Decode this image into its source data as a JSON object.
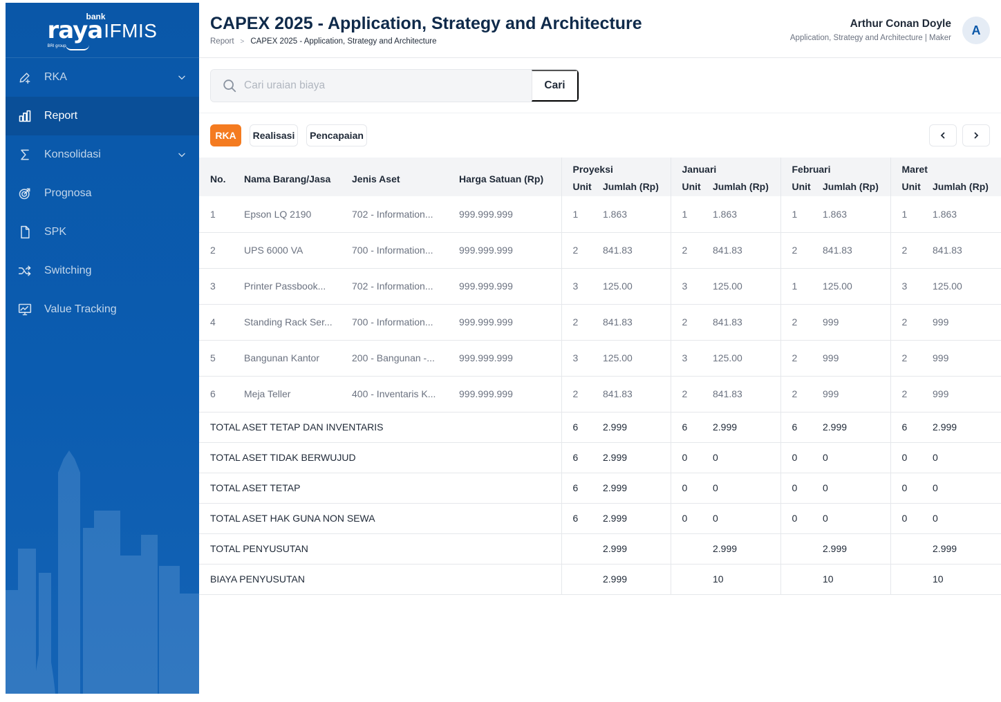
{
  "app": {
    "logo_bank": "bank",
    "logo_raya": "raya",
    "logo_ifmis": "IFMIS",
    "logo_sub": "BRI group"
  },
  "sidebar": {
    "items": [
      {
        "label": "RKA",
        "icon": "edit-plus-icon",
        "chevron": true
      },
      {
        "label": "Report",
        "icon": "bar-chart-icon",
        "active": true
      },
      {
        "label": "Konsolidasi",
        "icon": "sigma-icon",
        "chevron": true
      },
      {
        "label": "Prognosa",
        "icon": "target-icon"
      },
      {
        "label": "SPK",
        "icon": "file-icon"
      },
      {
        "label": "Switching",
        "icon": "shuffle-icon"
      },
      {
        "label": "Value Tracking",
        "icon": "monitor-chart-icon"
      }
    ]
  },
  "header": {
    "title": "CAPEX 2025 - Application, Strategy and Architecture",
    "breadcrumb": [
      "Report",
      "CAPEX 2025 - Application, Strategy and Architecture"
    ],
    "breadcrumb_sep": ">",
    "user_name": "Arthur Conan Doyle",
    "user_role": "Application, Strategy and Architecture | Maker",
    "avatar_initial": "A"
  },
  "search": {
    "placeholder": "Cari uraian biaya",
    "value": "",
    "button_label": "Cari"
  },
  "tabs": [
    {
      "label": "RKA",
      "active": true
    },
    {
      "label": "Realisasi",
      "active": false
    },
    {
      "label": "Pencapaian",
      "active": false
    }
  ],
  "pager": {
    "prev_icon": "chevron-left-icon",
    "next_icon": "chevron-right-icon"
  },
  "table": {
    "headers": {
      "no": "No.",
      "nama": "Nama Barang/Jasa",
      "jenis": "Jenis Aset",
      "harga": "Harga Satuan (Rp)",
      "unit": "Unit",
      "jumlah": "Jumlah (Rp)"
    },
    "groups": [
      "Proyeksi",
      "Januari",
      "Februari",
      "Maret"
    ],
    "rows": [
      {
        "no": "1",
        "nama": "Epson LQ 2190",
        "jenis": "702 - Information...",
        "harga": "999.999.999",
        "values": [
          [
            "1",
            "1.863"
          ],
          [
            "1",
            "1.863"
          ],
          [
            "1",
            "1.863"
          ],
          [
            "1",
            "1.863"
          ]
        ]
      },
      {
        "no": "2",
        "nama": "UPS 6000 VA",
        "jenis": "700 - Information...",
        "harga": "999.999.999",
        "values": [
          [
            "2",
            "841.83"
          ],
          [
            "2",
            "841.83"
          ],
          [
            "2",
            "841.83"
          ],
          [
            "2",
            "841.83"
          ]
        ]
      },
      {
        "no": "3",
        "nama": "Printer Passbook...",
        "jenis": "702 - Information...",
        "harga": "999.999.999",
        "values": [
          [
            "3",
            "125.00"
          ],
          [
            "3",
            "125.00"
          ],
          [
            "1",
            "125.00"
          ],
          [
            "3",
            "125.00"
          ]
        ]
      },
      {
        "no": "4",
        "nama": "Standing Rack Ser...",
        "jenis": "700 - Information...",
        "harga": "999.999.999",
        "values": [
          [
            "2",
            "841.83"
          ],
          [
            "2",
            "841.83"
          ],
          [
            "2",
            "999"
          ],
          [
            "2",
            "999"
          ]
        ]
      },
      {
        "no": "5",
        "nama": "Bangunan Kantor",
        "jenis": "200 - Bangunan -...",
        "harga": "999.999.999",
        "values": [
          [
            "3",
            "125.00"
          ],
          [
            "3",
            "125.00"
          ],
          [
            "2",
            "999"
          ],
          [
            "2",
            "999"
          ]
        ]
      },
      {
        "no": "6",
        "nama": "Meja Teller",
        "jenis": "400 - Inventaris K...",
        "harga": "999.999.999",
        "values": [
          [
            "2",
            "841.83"
          ],
          [
            "2",
            "841.83"
          ],
          [
            "2",
            "999"
          ],
          [
            "2",
            "999"
          ]
        ]
      }
    ],
    "totals": [
      {
        "label": "TOTAL ASET TETAP DAN INVENTARIS",
        "values": [
          [
            "6",
            "2.999"
          ],
          [
            "6",
            "2.999"
          ],
          [
            "6",
            "2.999"
          ],
          [
            "6",
            "2.999"
          ]
        ]
      },
      {
        "label": "TOTAL ASET TIDAK BERWUJUD",
        "values": [
          [
            "6",
            "2.999"
          ],
          [
            "0",
            "0"
          ],
          [
            "0",
            "0"
          ],
          [
            "0",
            "0"
          ]
        ]
      },
      {
        "label": "TOTAL ASET TETAP",
        "values": [
          [
            "6",
            "2.999"
          ],
          [
            "0",
            "0"
          ],
          [
            "0",
            "0"
          ],
          [
            "0",
            "0"
          ]
        ]
      },
      {
        "label": "TOTAL ASET HAK GUNA NON SEWA",
        "values": [
          [
            "6",
            "2.999"
          ],
          [
            "0",
            "0"
          ],
          [
            "0",
            "0"
          ],
          [
            "0",
            "0"
          ]
        ]
      },
      {
        "label": "TOTAL PENYUSUTAN",
        "values": [
          [
            "",
            "2.999"
          ],
          [
            "",
            "2.999"
          ],
          [
            "",
            "2.999"
          ],
          [
            "",
            "2.999"
          ]
        ]
      },
      {
        "label": "BIAYA PENYUSUTAN",
        "values": [
          [
            "",
            "2.999"
          ],
          [
            "",
            "10"
          ],
          [
            "",
            "10"
          ],
          [
            "",
            "10"
          ]
        ]
      }
    ]
  }
}
